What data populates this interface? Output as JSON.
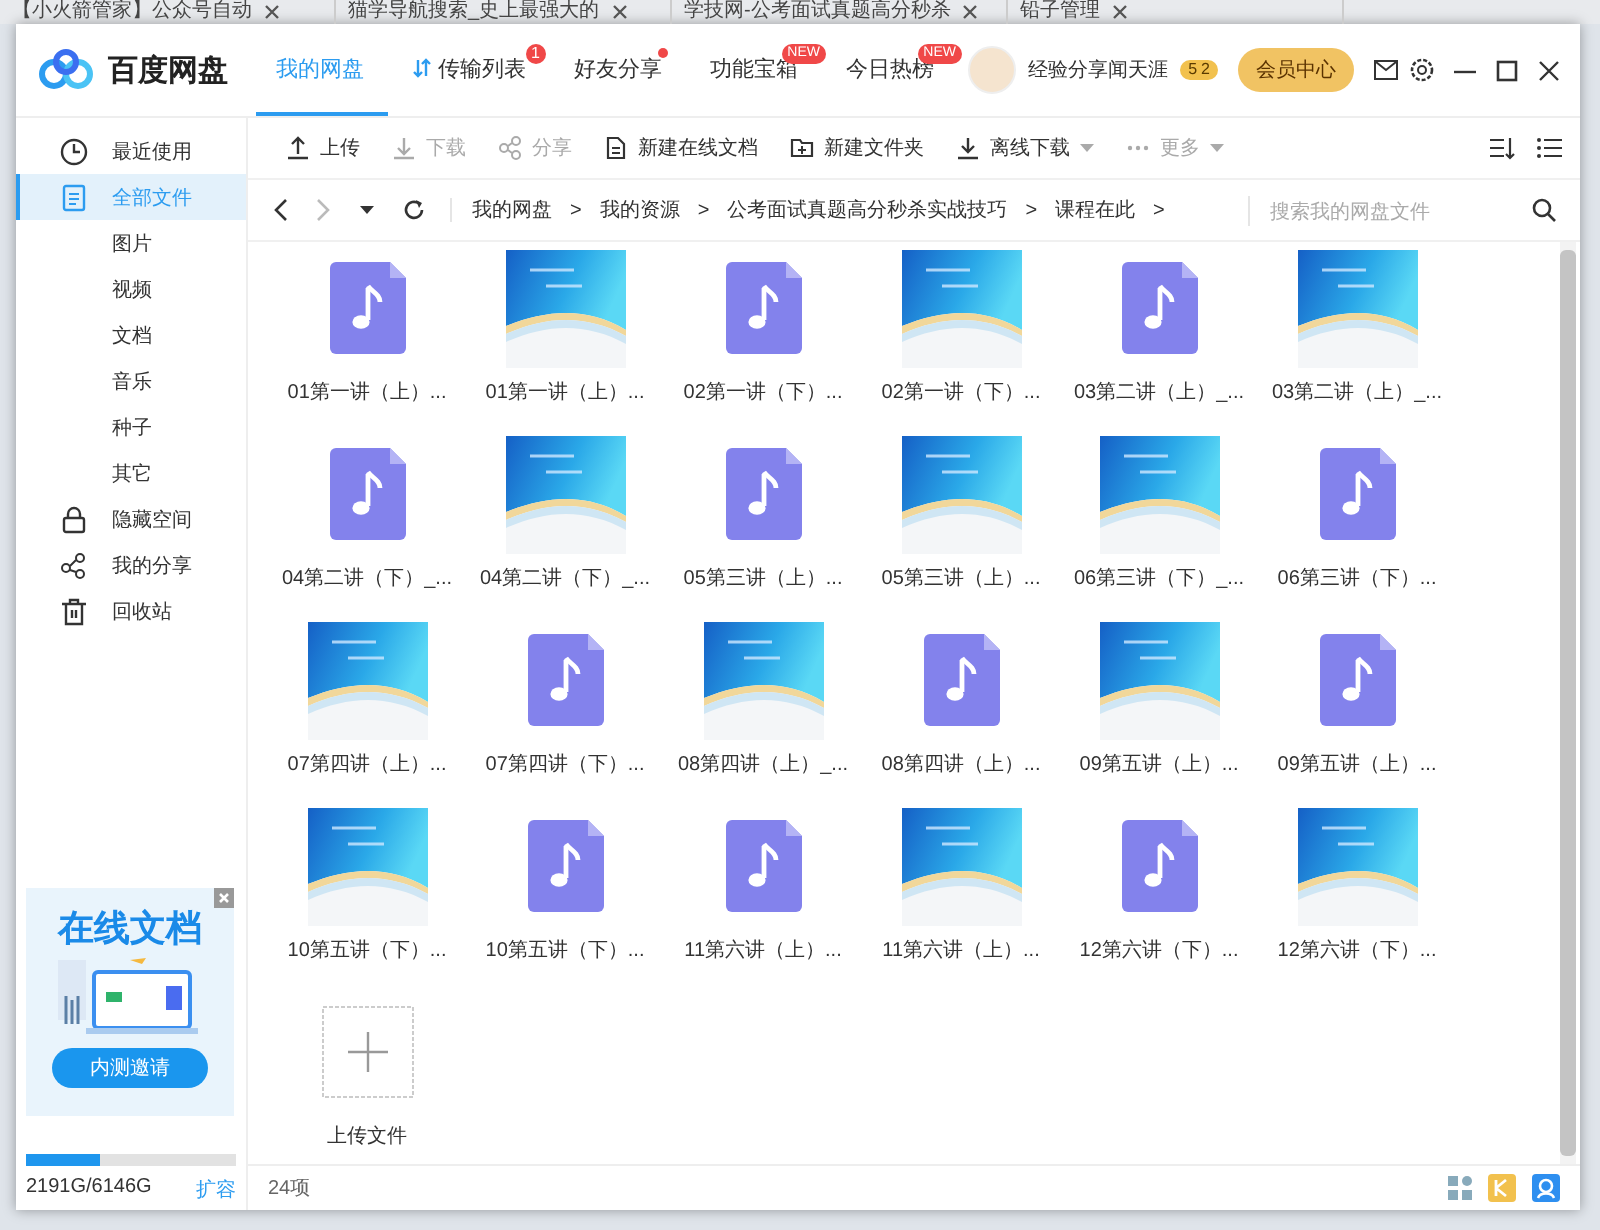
{
  "browser_tabs": [
    {
      "title": "【小火箭管家】公众号自动"
    },
    {
      "title": "猫学导航搜索_史上最强大的"
    },
    {
      "title": "学技网-公考面试真题高分秒杀"
    },
    {
      "title": "铅子管理"
    }
  ],
  "topbar": {
    "logo": "百度网盘",
    "nav": [
      {
        "label": "我的网盘",
        "selected": true,
        "has_icon": false,
        "dot": false
      },
      {
        "label": "传输列表",
        "selected": false,
        "has_icon": true,
        "badge": "1",
        "dot": false
      },
      {
        "label": "好友分享",
        "selected": false,
        "has_icon": false,
        "dot": true
      },
      {
        "label": "功能宝箱",
        "selected": false,
        "has_icon": false,
        "badge": "NEW",
        "dot": false
      },
      {
        "label": "今日热榜",
        "selected": false,
        "has_icon": false,
        "badge": "NEW",
        "dot": false
      }
    ],
    "user": {
      "name": "经验分享闻天涯",
      "level": [
        "5",
        "2"
      ]
    },
    "vip_button": "会员中心"
  },
  "sidebar": {
    "items": [
      {
        "label": "最近使用",
        "kind": "main",
        "selected": false
      },
      {
        "label": "全部文件",
        "kind": "main",
        "selected": true
      },
      {
        "label": "图片",
        "kind": "sub",
        "selected": false
      },
      {
        "label": "视频",
        "kind": "sub",
        "selected": false
      },
      {
        "label": "文档",
        "kind": "sub",
        "selected": false
      },
      {
        "label": "音乐",
        "kind": "sub",
        "selected": false
      },
      {
        "label": "种子",
        "kind": "sub",
        "selected": false
      },
      {
        "label": "其它",
        "kind": "sub",
        "selected": false
      },
      {
        "label": "隐藏空间",
        "kind": "main",
        "selected": false
      },
      {
        "label": "我的分享",
        "kind": "main",
        "selected": false
      },
      {
        "label": "回收站",
        "kind": "main",
        "selected": false
      }
    ],
    "ad": {
      "title": "在线文档",
      "button": "内测邀请"
    },
    "storage": {
      "level": 0.356,
      "reading": "2191G/6146G",
      "expand": "扩容"
    }
  },
  "toolbar": {
    "buttons": [
      {
        "label": "上传",
        "disabled": false,
        "dropdown": false
      },
      {
        "label": "下载",
        "disabled": true,
        "dropdown": false
      },
      {
        "label": "分享",
        "disabled": true,
        "dropdown": false
      },
      {
        "label": "新建在线文档",
        "disabled": false,
        "dropdown": false
      },
      {
        "label": "新建文件夹",
        "disabled": false,
        "dropdown": false
      },
      {
        "label": "离线下载",
        "disabled": false,
        "dropdown": true
      },
      {
        "label": "更多",
        "disabled": true,
        "dropdown": true
      }
    ]
  },
  "breadcrumb": {
    "path": [
      "我的网盘",
      "我的资源",
      "公考面试真题高分秒杀实战技巧",
      "课程在此"
    ],
    "separator": ">",
    "search": {
      "placeholder": "搜索我的网盘文件"
    }
  },
  "files": [
    {
      "name": "01第一讲（上）...",
      "kind": "audio"
    },
    {
      "name": "01第一讲（上）...",
      "kind": "image"
    },
    {
      "name": "02第一讲（下）...",
      "kind": "audio"
    },
    {
      "name": "02第一讲（下）...",
      "kind": "image"
    },
    {
      "name": "03第二讲（上）_...",
      "kind": "audio"
    },
    {
      "name": "03第二讲（上）_...",
      "kind": "image"
    },
    {
      "name": "04第二讲（下）_...",
      "kind": "audio"
    },
    {
      "name": "04第二讲（下）_...",
      "kind": "image"
    },
    {
      "name": "05第三讲（上）...",
      "kind": "audio"
    },
    {
      "name": "05第三讲（上）...",
      "kind": "image"
    },
    {
      "name": "06第三讲（下）_...",
      "kind": "image"
    },
    {
      "name": "06第三讲（下）...",
      "kind": "audio"
    },
    {
      "name": "07第四讲（上）...",
      "kind": "image"
    },
    {
      "name": "07第四讲（下）...",
      "kind": "audio"
    },
    {
      "name": "08第四讲（上）_...",
      "kind": "image"
    },
    {
      "name": "08第四讲（上）...",
      "kind": "audio"
    },
    {
      "name": "09第五讲（上）...",
      "kind": "image"
    },
    {
      "name": "09第五讲（上）...",
      "kind": "audio"
    },
    {
      "name": "10第五讲（下）...",
      "kind": "image"
    },
    {
      "name": "10第五讲（下）...",
      "kind": "audio"
    },
    {
      "name": "11第六讲（上）...",
      "kind": "audio"
    },
    {
      "name": "11第六讲（上）...",
      "kind": "image"
    },
    {
      "name": "12第六讲（下）...",
      "kind": "audio"
    },
    {
      "name": "12第六讲（下）...",
      "kind": "image"
    }
  ],
  "upload_tile": {
    "label": "上传文件"
  },
  "status_bar": {
    "count": "24项"
  }
}
